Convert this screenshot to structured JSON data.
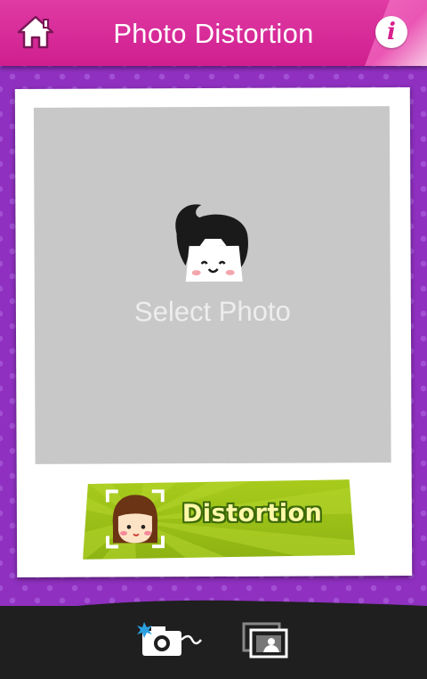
{
  "header": {
    "title": "Photo Distortion",
    "home_icon": "home-icon",
    "info_icon": "info-icon",
    "info_glyph": "i"
  },
  "photo": {
    "placeholder_label": "Select Photo",
    "placeholder_icon": "mascot-icon"
  },
  "action": {
    "distort_label": "Distortion",
    "distort_icon": "girl-face-icon"
  },
  "toolbar": {
    "camera_icon": "camera-icon",
    "gallery_icon": "gallery-icon"
  },
  "colors": {
    "header": "#d82a98",
    "background": "#8f30c0",
    "button": "#9bc11a",
    "toolbar": "#1f1f1f"
  }
}
